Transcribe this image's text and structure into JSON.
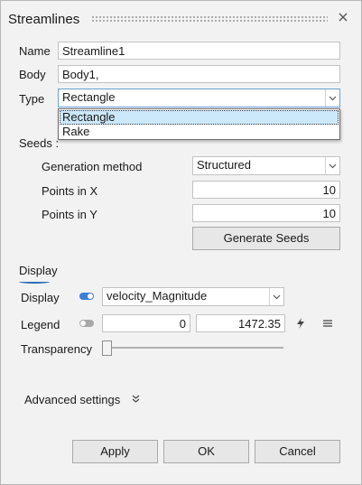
{
  "dialog": {
    "title": "Streamlines"
  },
  "name": {
    "label": "Name",
    "value": "Streamline1"
  },
  "body": {
    "label": "Body",
    "value": "Body1,"
  },
  "type": {
    "label": "Type",
    "value": "Rectangle",
    "options": [
      "Rectangle",
      "Rake"
    ]
  },
  "seeds": {
    "header": "Seeds :",
    "generation_method_label": "Generation method",
    "generation_method_value": "Structured",
    "points_x_label": "Points in X",
    "points_x_value": "10",
    "points_y_label": "Points in Y",
    "points_y_value": "10",
    "generate_button": "Generate Seeds"
  },
  "display": {
    "header": "Display",
    "display_label": "Display",
    "display_toggle_on": true,
    "display_value": "velocity_Magnitude",
    "legend_label": "Legend",
    "legend_toggle_on": false,
    "legend_min": "0",
    "legend_max": "1472.35",
    "transparency_label": "Transparency",
    "transparency_level": 0
  },
  "advanced": {
    "label": "Advanced settings"
  },
  "footer": {
    "apply": "Apply",
    "ok": "OK",
    "cancel": "Cancel"
  },
  "colors": {
    "accent": "#2e6db8",
    "toggle_on": "#3b7fd6",
    "toggle_off": "#a8a8a8",
    "selection": "#cce8fb"
  }
}
